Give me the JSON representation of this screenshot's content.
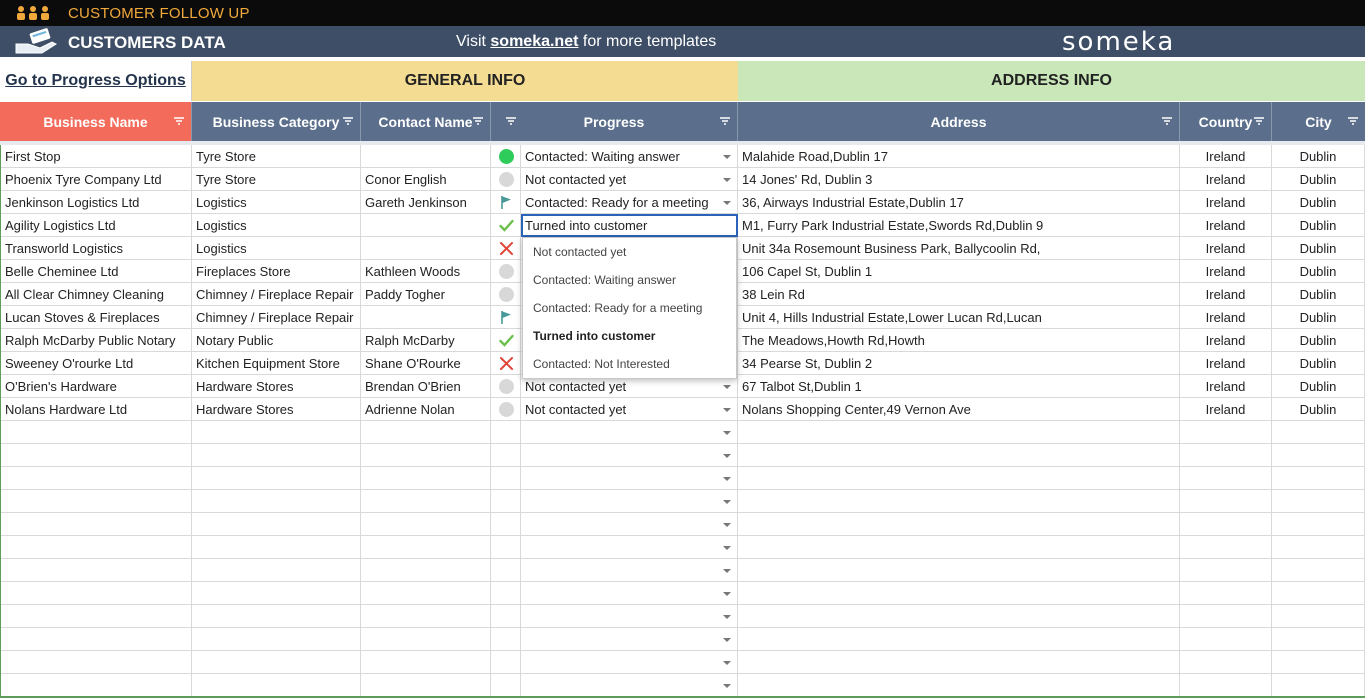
{
  "header": {
    "app_title": "CUSTOMER FOLLOW UP",
    "subtitle": "CUSTOMERS DATA",
    "visit_prefix": "Visit",
    "visit_link": "someka.net",
    "visit_suffix": "for more templates",
    "brand": "someka"
  },
  "groups": {
    "link": "Go to Progress Options",
    "general": "GENERAL INFO",
    "address": "ADDRESS INFO"
  },
  "columns": {
    "business": "Business Name",
    "category": "Business Category",
    "contact": "Contact Name",
    "progress": "Progress",
    "address": "Address",
    "country": "Country",
    "city": "City"
  },
  "rows": [
    {
      "business": "First Stop",
      "category": "Tyre Store",
      "contact": "",
      "icon": "green-dot",
      "progress": "Contacted: Waiting answer",
      "address": "Malahide Road,Dublin 17",
      "country": "Ireland",
      "city": "Dublin"
    },
    {
      "business": "Phoenix Tyre Company Ltd",
      "category": "Tyre Store",
      "contact": "Conor English",
      "icon": "grey-dot",
      "progress": "Not contacted yet",
      "address": "14 Jones' Rd, Dublin 3",
      "country": "Ireland",
      "city": "Dublin"
    },
    {
      "business": "Jenkinson Logistics Ltd",
      "category": "Logistics",
      "contact": "Gareth Jenkinson",
      "icon": "flag",
      "progress": "Contacted: Ready for a meeting",
      "address": "36, Airways Industrial Estate,Dublin 17",
      "country": "Ireland",
      "city": "Dublin"
    },
    {
      "business": "Agility Logistics Ltd",
      "category": "Logistics",
      "contact": "",
      "icon": "check",
      "progress": "Turned into customer",
      "address": "M1, Furry Park Industrial Estate,Swords Rd,Dublin 9",
      "country": "Ireland",
      "city": "Dublin"
    },
    {
      "business": "Transworld Logistics",
      "category": "Logistics",
      "contact": "",
      "icon": "cross",
      "progress": "",
      "address": "Unit 34a Rosemount Business Park, Ballycoolin Rd,",
      "country": "Ireland",
      "city": "Dublin"
    },
    {
      "business": "Belle Cheminee Ltd",
      "category": "Fireplaces Store",
      "contact": "Kathleen Woods",
      "icon": "grey-dot",
      "progress": "",
      "address": "106 Capel St, Dublin 1",
      "country": "Ireland",
      "city": "Dublin"
    },
    {
      "business": "All Clear Chimney Cleaning",
      "category": "Chimney / Fireplace Repair",
      "contact": "Paddy Togher",
      "icon": "grey-dot",
      "progress": "",
      "address": "38 Lein Rd",
      "country": "Ireland",
      "city": "Dublin"
    },
    {
      "business": "Lucan Stoves & Fireplaces",
      "category": "Chimney / Fireplace Repair",
      "contact": "",
      "icon": "flag",
      "progress": "",
      "address": "Unit 4, Hills Industrial Estate,Lower Lucan Rd,Lucan",
      "country": "Ireland",
      "city": "Dublin"
    },
    {
      "business": "Ralph McDarby Public Notary",
      "category": "Notary Public",
      "contact": "Ralph McDarby",
      "icon": "check",
      "progress": "",
      "address": "The Meadows,Howth Rd,Howth",
      "country": "Ireland",
      "city": "Dublin"
    },
    {
      "business": "Sweeney O'rourke Ltd",
      "category": "Kitchen Equipment Store",
      "contact": "Shane O'Rourke",
      "icon": "cross",
      "progress": "",
      "address": "34 Pearse St, Dublin 2",
      "country": "Ireland",
      "city": "Dublin"
    },
    {
      "business": "O'Brien's Hardware",
      "category": "Hardware Stores",
      "contact": "Brendan O'Brien",
      "icon": "grey-dot",
      "progress": "Not contacted yet",
      "address": "67 Talbot St,Dublin 1",
      "country": "Ireland",
      "city": "Dublin"
    },
    {
      "business": "Nolans Hardware Ltd",
      "category": "Hardware Stores",
      "contact": "Adrienne Nolan",
      "icon": "grey-dot",
      "progress": "Not contacted yet",
      "address": "Nolans Shopping Center,49 Vernon Ave",
      "country": "Ireland",
      "city": "Dublin"
    }
  ],
  "dropdown": {
    "options": [
      "Not contacted yet",
      "Contacted: Waiting answer",
      "Contacted: Ready for a meeting",
      "Turned into customer",
      "Contacted: Not Interested"
    ],
    "selected_index": 3
  },
  "colors": {
    "title_bar": "#0b0b0b",
    "title_text": "#f1a93b",
    "sub_bar": "#3d4e66",
    "general_group": "#f5dc93",
    "address_group": "#c9e7b8",
    "col_header": "#5b6f8c",
    "first_col_header": "#f26b5b",
    "status_green": "#2ecc5a",
    "status_red": "#e0453a",
    "flag": "#4a9a9a"
  }
}
